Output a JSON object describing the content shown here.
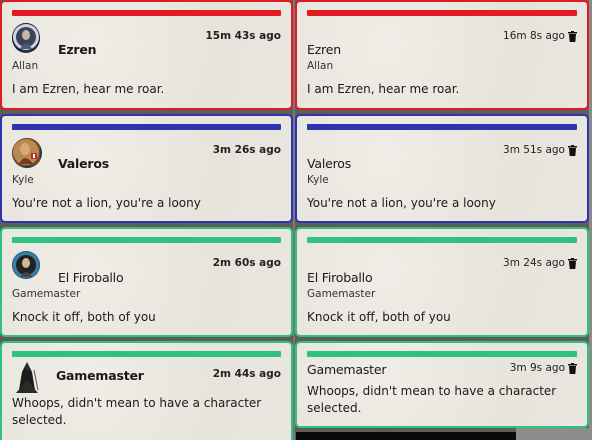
{
  "colors": {
    "red": "#e11b22",
    "blue": "#2e33b0",
    "green": "#2ec27e"
  },
  "left": [
    {
      "color": "red",
      "name": "Ezren",
      "player": "Allan",
      "time": "15m 43s ago",
      "message": "I am Ezren, hear me roar.",
      "avatar_icon": "ezren-portrait-icon"
    },
    {
      "color": "blue",
      "name": "Valeros",
      "player": "Kyle",
      "time": "3m 26s ago",
      "message": "You're not a lion, you're a loony",
      "avatar_icon": "valeros-portrait-icon"
    },
    {
      "color": "green",
      "name": "El Firoballo",
      "player": "Gamemaster",
      "time": "2m 60s ago",
      "message": "Knock it off, both of you",
      "avatar_icon": "firoballo-portrait-icon"
    },
    {
      "color": "green",
      "name": "Gamemaster",
      "time": "2m 44s ago",
      "message_line1": "Whoops, didn't mean to have a character",
      "message_line2": "selected.",
      "avatar_icon": "hooded-figure-icon"
    }
  ],
  "right": [
    {
      "color": "red",
      "name": "Ezren",
      "player": "Allan",
      "time": "16m 8s ago",
      "message": "I am Ezren, hear me roar."
    },
    {
      "color": "blue",
      "name": "Valeros",
      "player": "Kyle",
      "time": "3m 51s ago",
      "message": "You're not a lion, you're a loony"
    },
    {
      "color": "green",
      "name": "El Firoballo",
      "player": "Gamemaster",
      "time": "3m 24s ago",
      "message": "Knock it off, both of you"
    },
    {
      "color": "green",
      "name": "Gamemaster",
      "time": "3m 9s ago",
      "message_line1": "Whoops, didn't mean to have a character",
      "message_line2": "selected."
    }
  ]
}
